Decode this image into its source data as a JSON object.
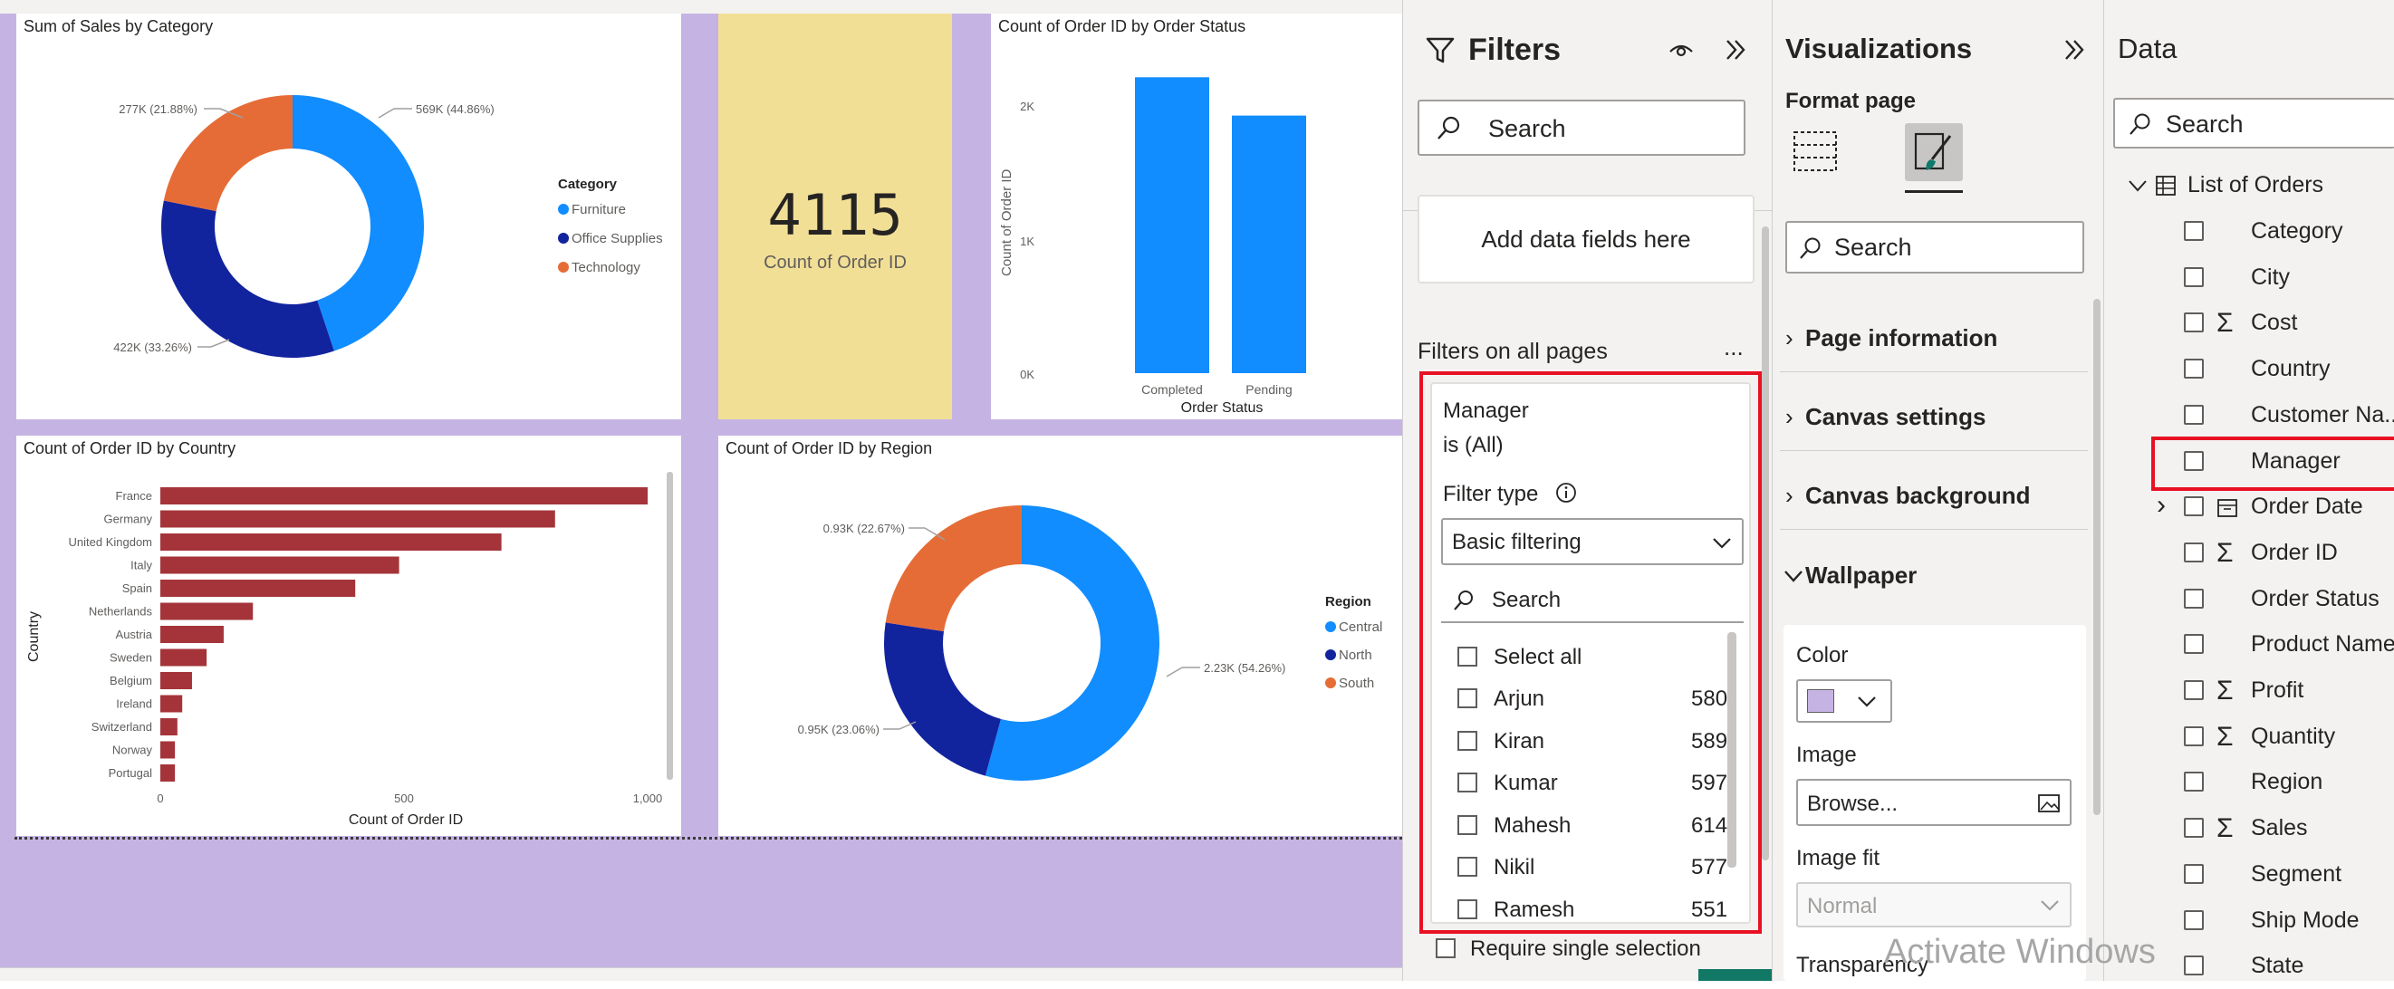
{
  "canvas": {
    "kpi": {
      "value": "4115",
      "label": "Count of Order ID"
    }
  },
  "charts": {
    "category": {
      "title": "Sum of Sales by Category",
      "legend_title": "Category",
      "legend": [
        "Furniture",
        "Office Supplies",
        "Technology"
      ],
      "labels": [
        "569K (44.86%)",
        "422K (33.26%)",
        "277K (21.88%)"
      ]
    },
    "status": {
      "title": "Count of Order ID by Order Status",
      "xlabel": "Order Status",
      "ylabel": "Count of Order ID",
      "yticks": [
        "2K",
        "1K",
        "0K"
      ],
      "categories": [
        "Completed",
        "Pending"
      ]
    },
    "country": {
      "title": "Count of Order ID by Country",
      "xlabel": "Count of Order ID",
      "ylabel": "Country",
      "xticks": [
        "0",
        "500",
        "1,000"
      ],
      "categories": [
        "France",
        "Germany",
        "United Kingdom",
        "Italy",
        "Spain",
        "Netherlands",
        "Austria",
        "Sweden",
        "Belgium",
        "Ireland",
        "Switzerland",
        "Norway",
        "Portugal"
      ]
    },
    "region": {
      "title": "Count of Order ID by Region",
      "legend_title": "Region",
      "legend": [
        "Central",
        "North",
        "South"
      ],
      "labels": [
        "2.23K (54.26%)",
        "0.95K (23.06%)",
        "0.93K (22.67%)"
      ]
    }
  },
  "chart_data": [
    {
      "type": "pie",
      "title": "Sum of Sales by Category",
      "categories": [
        "Furniture",
        "Office Supplies",
        "Technology"
      ],
      "values": [
        569,
        422,
        277
      ],
      "percent": [
        44.86,
        33.26,
        21.88
      ],
      "unit": "K",
      "colors": [
        "#118dff",
        "#12239e",
        "#e66c37"
      ],
      "donut": true,
      "legend_position": "right"
    },
    {
      "type": "bar",
      "title": "Count of Order ID by Order Status",
      "categories": [
        "Completed",
        "Pending"
      ],
      "values": [
        2200,
        1915
      ],
      "xlabel": "Order Status",
      "ylabel": "Count of Order ID",
      "ylim": [
        0,
        2400
      ],
      "color": "#118dff"
    },
    {
      "type": "bar",
      "orientation": "horizontal",
      "title": "Count of Order ID by Country",
      "categories": [
        "France",
        "Germany",
        "United Kingdom",
        "Italy",
        "Spain",
        "Netherlands",
        "Austria",
        "Sweden",
        "Belgium",
        "Ireland",
        "Switzerland",
        "Norway",
        "Portugal"
      ],
      "values": [
        1000,
        810,
        700,
        490,
        400,
        190,
        130,
        95,
        65,
        45,
        35,
        30,
        30
      ],
      "xlabel": "Count of Order ID",
      "ylabel": "Country",
      "xlim": [
        0,
        1050
      ],
      "color": "#a4343a"
    },
    {
      "type": "pie",
      "title": "Count of Order ID by Region",
      "categories": [
        "Central",
        "North",
        "South"
      ],
      "values": [
        2.23,
        0.95,
        0.93
      ],
      "percent": [
        54.26,
        23.06,
        22.67
      ],
      "unit": "K",
      "colors": [
        "#118dff",
        "#12239e",
        "#e66c37"
      ],
      "donut": true,
      "legend_position": "right"
    }
  ],
  "filters": {
    "title": "Filters",
    "search_placeholder": "Search",
    "add_fields": "Add data fields here",
    "all_pages": "Filters on all pages",
    "more": "...",
    "card": {
      "field": "Manager",
      "state": "is (All)",
      "filter_type_label": "Filter type",
      "filter_type_value": "Basic filtering",
      "search": "Search",
      "select_all": "Select all",
      "items": [
        {
          "name": "Arjun",
          "count": "580"
        },
        {
          "name": "Kiran",
          "count": "589"
        },
        {
          "name": "Kumar",
          "count": "597"
        },
        {
          "name": "Mahesh",
          "count": "614"
        },
        {
          "name": "Nikil",
          "count": "577"
        },
        {
          "name": "Ramesh",
          "count": "551"
        }
      ]
    },
    "require_single": "Require single selection"
  },
  "visualizations": {
    "title": "Visualizations",
    "subtitle": "Format page",
    "search": "Search",
    "sections": [
      "Page information",
      "Canvas settings",
      "Canvas background",
      "Wallpaper"
    ],
    "color_label": "Color",
    "color_value": "#c5b4e3",
    "image_label": "Image",
    "browse": "Browse...",
    "image_fit_label": "Image fit",
    "image_fit_value": "Normal",
    "transparency_label": "Transparency"
  },
  "data": {
    "title": "Data",
    "search": "Search",
    "table": "List of Orders",
    "fields": [
      {
        "name": "Category",
        "sigma": ""
      },
      {
        "name": "City",
        "sigma": ""
      },
      {
        "name": "Cost",
        "sigma": "Σ"
      },
      {
        "name": "Country",
        "sigma": ""
      },
      {
        "name": "Customer Na...",
        "sigma": ""
      },
      {
        "name": "Manager",
        "sigma": ""
      },
      {
        "name": "Order Date",
        "sigma": ""
      },
      {
        "name": "Order ID",
        "sigma": "Σ"
      },
      {
        "name": "Order Status",
        "sigma": ""
      },
      {
        "name": "Product Name",
        "sigma": ""
      },
      {
        "name": "Profit",
        "sigma": "Σ"
      },
      {
        "name": "Quantity",
        "sigma": "Σ"
      },
      {
        "name": "Region",
        "sigma": ""
      },
      {
        "name": "Sales",
        "sigma": "Σ"
      },
      {
        "name": "Segment",
        "sigma": ""
      },
      {
        "name": "Ship Mode",
        "sigma": ""
      },
      {
        "name": "State",
        "sigma": ""
      }
    ]
  },
  "watermark": "Activate Windows"
}
